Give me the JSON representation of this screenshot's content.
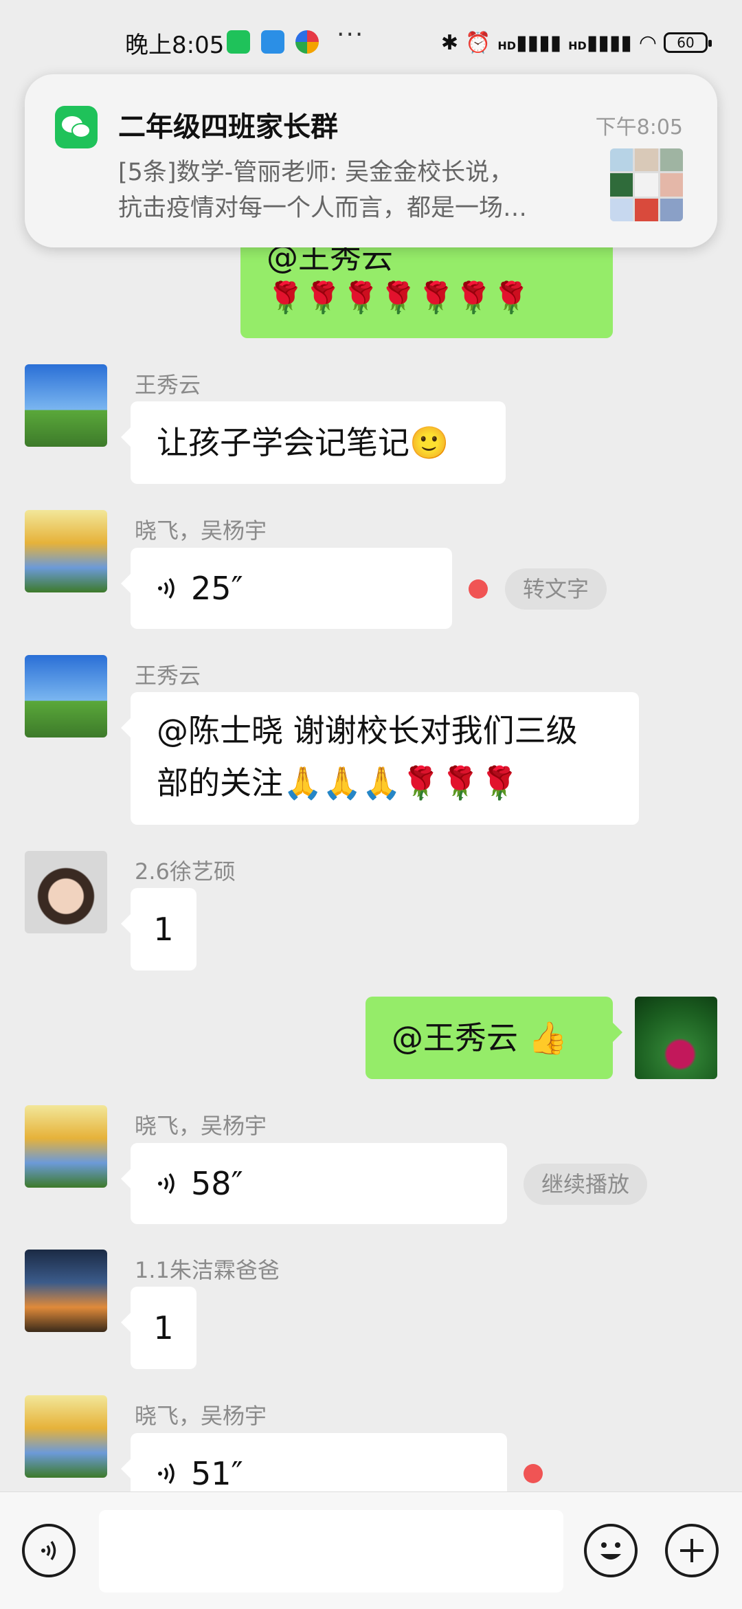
{
  "status_bar": {
    "time": "晚上8:05",
    "more": "···",
    "battery": "60",
    "signal_label": "HD"
  },
  "notification": {
    "app_icon": "wechat-icon",
    "title": "二年级四班家长群",
    "time": "下午8:05",
    "line1": "[5条]数学-管丽老师: 吴金金校长说，",
    "line2": "抗击疫情对每一个人而言，都是一场…",
    "colors": [
      "#b7d3e6",
      "#d9c9b8",
      "#9fb4a2",
      "#2f6b3a",
      "#f2f2f2",
      "#e4b7a8",
      "#c7d8ef",
      "#d94a3c",
      "#8aa0c7"
    ]
  },
  "messages": [
    {
      "type": "partial_text",
      "align": "right",
      "text": "@王秀云",
      "emoji": "🌹🌹🌹🌹🌹🌹🌹"
    },
    {
      "type": "text",
      "sender": "王秀云",
      "text": "让孩子学会记笔记🙂"
    },
    {
      "type": "voice",
      "sender": "晓飞，吴杨宇",
      "duration": "25″",
      "action": "转文字",
      "unread": true
    },
    {
      "type": "text",
      "sender": "王秀云",
      "text_line1": "@陈士晓  谢谢校长对我们三级",
      "text_line2": "部的关注🙏🙏🙏🌹🌹🌹"
    },
    {
      "type": "text",
      "sender": "2.6徐艺硕",
      "text": "1"
    },
    {
      "type": "text",
      "align": "right",
      "text": "@王秀云 👍"
    },
    {
      "type": "voice",
      "sender": "晓飞，吴杨宇",
      "duration": "58″",
      "action": "继续播放"
    },
    {
      "type": "text",
      "sender": "1.1朱洁霖爸爸",
      "text": "1"
    },
    {
      "type": "voice",
      "sender": "晓飞，吴杨宇",
      "duration": "51″",
      "unread": true
    }
  ],
  "input_bar": {
    "voice_button": "voice-toggle-icon",
    "emoji_button": "emoji-icon",
    "add_button": "plus-icon"
  }
}
